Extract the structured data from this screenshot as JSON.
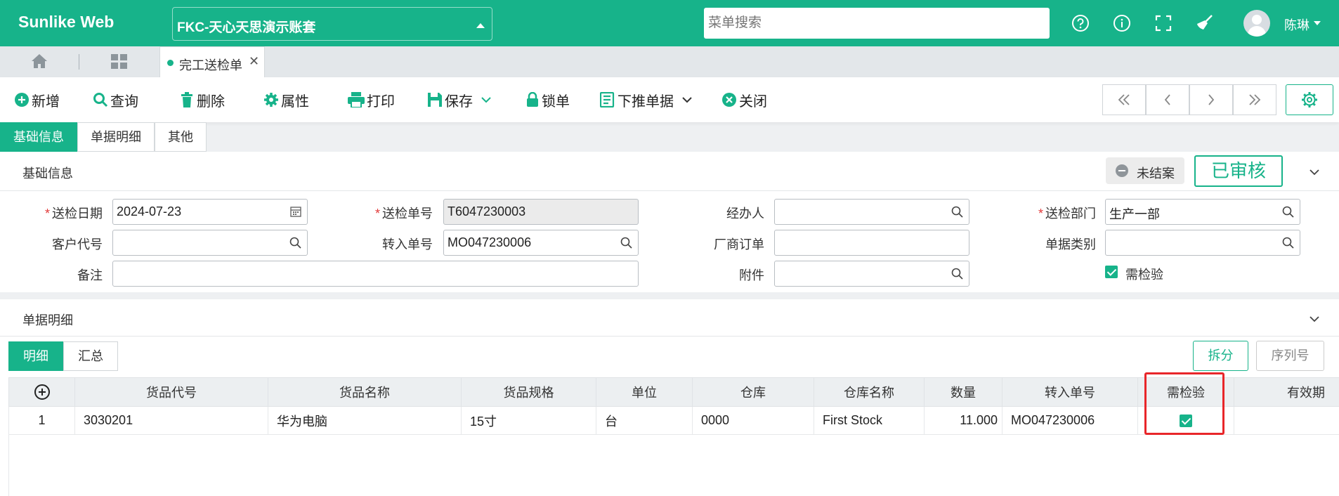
{
  "app": {
    "brand": "Sunlike Web",
    "account": "FKC-天心天思演示账套",
    "search_placeholder": "菜单搜索",
    "user": "陈琳"
  },
  "tabs": {
    "document_tab": "完工送检单"
  },
  "toolbar": {
    "add": "新增",
    "query": "查询",
    "delete": "删除",
    "properties": "属性",
    "print": "打印",
    "save": "保存",
    "lock": "锁单",
    "push_down": "下推单据",
    "close": "关闭"
  },
  "section_tabs": [
    "基础信息",
    "单据明细",
    "其他"
  ],
  "basic": {
    "title": "基础信息",
    "status_unclosed": "未结案",
    "status_approved": "已审核",
    "fields": {
      "inspect_date_label": "送检日期",
      "inspect_date": "2024-07-23",
      "inspect_no_label": "送检单号",
      "inspect_no": "T6047230003",
      "handler_label": "经办人",
      "handler": "",
      "dept_label": "送检部门",
      "dept": "生产一部",
      "customer_label": "客户代号",
      "customer": "",
      "transfer_no_label": "转入单号",
      "transfer_no": "MO047230006",
      "vendor_order_label": "厂商订单",
      "vendor_order": "",
      "doc_type_label": "单据类别",
      "doc_type": "",
      "remark_label": "备注",
      "remark": "",
      "attachment_label": "附件",
      "attachment": "",
      "need_inspect_label": "需检验",
      "need_inspect": true
    }
  },
  "detail": {
    "title": "单据明细",
    "subtabs": [
      "明细",
      "汇总"
    ],
    "split_button": "拆分",
    "serial_button": "序列号",
    "columns": [
      "货品代号",
      "货品名称",
      "货品规格",
      "单位",
      "仓库",
      "仓库名称",
      "数量",
      "转入单号",
      "需检验",
      "有效期"
    ],
    "rows": [
      {
        "no": "1",
        "code": "3030201",
        "name": "华为电脑",
        "spec": "15寸",
        "unit": "台",
        "warehouse": "0000",
        "warehouse_name": "First Stock",
        "qty": "11.000",
        "transfer_no": "MO047230006",
        "need_inspect": true,
        "expiry": ""
      }
    ]
  },
  "colors": {
    "brand": "#17b38a",
    "highlight": "#e8262a"
  }
}
